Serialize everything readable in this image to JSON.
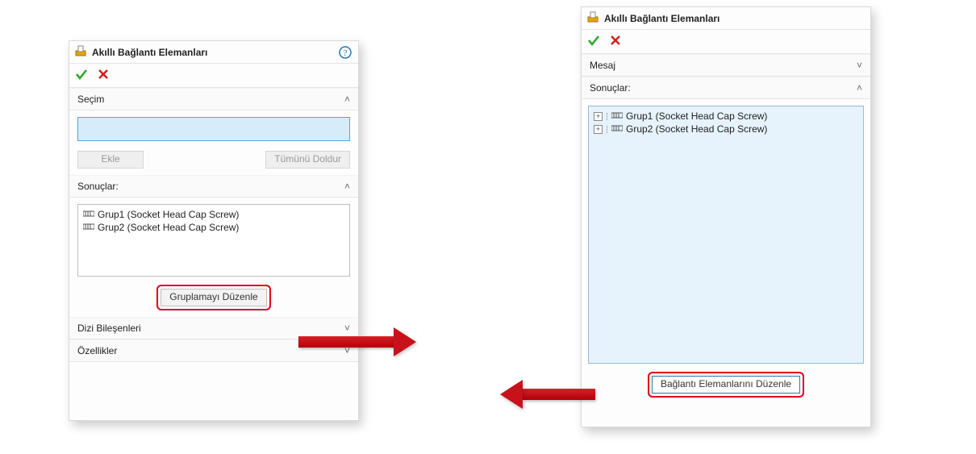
{
  "left_panel": {
    "title": "Akıllı Bağlantı Elemanları",
    "sections": {
      "secim": {
        "header": "Seçim",
        "add_btn": "Ekle",
        "fill_all_btn": "Tümünü Doldur"
      },
      "sonuc": {
        "header": "Sonuçlar:",
        "items": [
          "Grup1 (Socket Head Cap Screw)",
          "Grup2 (Socket Head Cap Screw)"
        ],
        "edit_btn": "Gruplamayı Düzenle"
      },
      "dizi": {
        "header": "Dizi Bileşenleri"
      },
      "ozellik": {
        "header": "Özellikler"
      }
    }
  },
  "right_panel": {
    "title": "Akıllı Bağlantı Elemanları",
    "sections": {
      "mesaj": {
        "header": "Mesaj"
      },
      "sonuc": {
        "header": "Sonuçlar:",
        "items": [
          "Grup1 (Socket Head Cap Screw)",
          "Grup2 (Socket Head Cap Screw)"
        ],
        "edit_btn": "Bağlantı Elemanlarını Düzenle"
      }
    }
  },
  "icons": {
    "help_glyph": "?",
    "check_color": "#2ba62b",
    "x_color": "#d02020",
    "chevron_up": "˄",
    "chevron_down": "˅",
    "plus": "+"
  }
}
